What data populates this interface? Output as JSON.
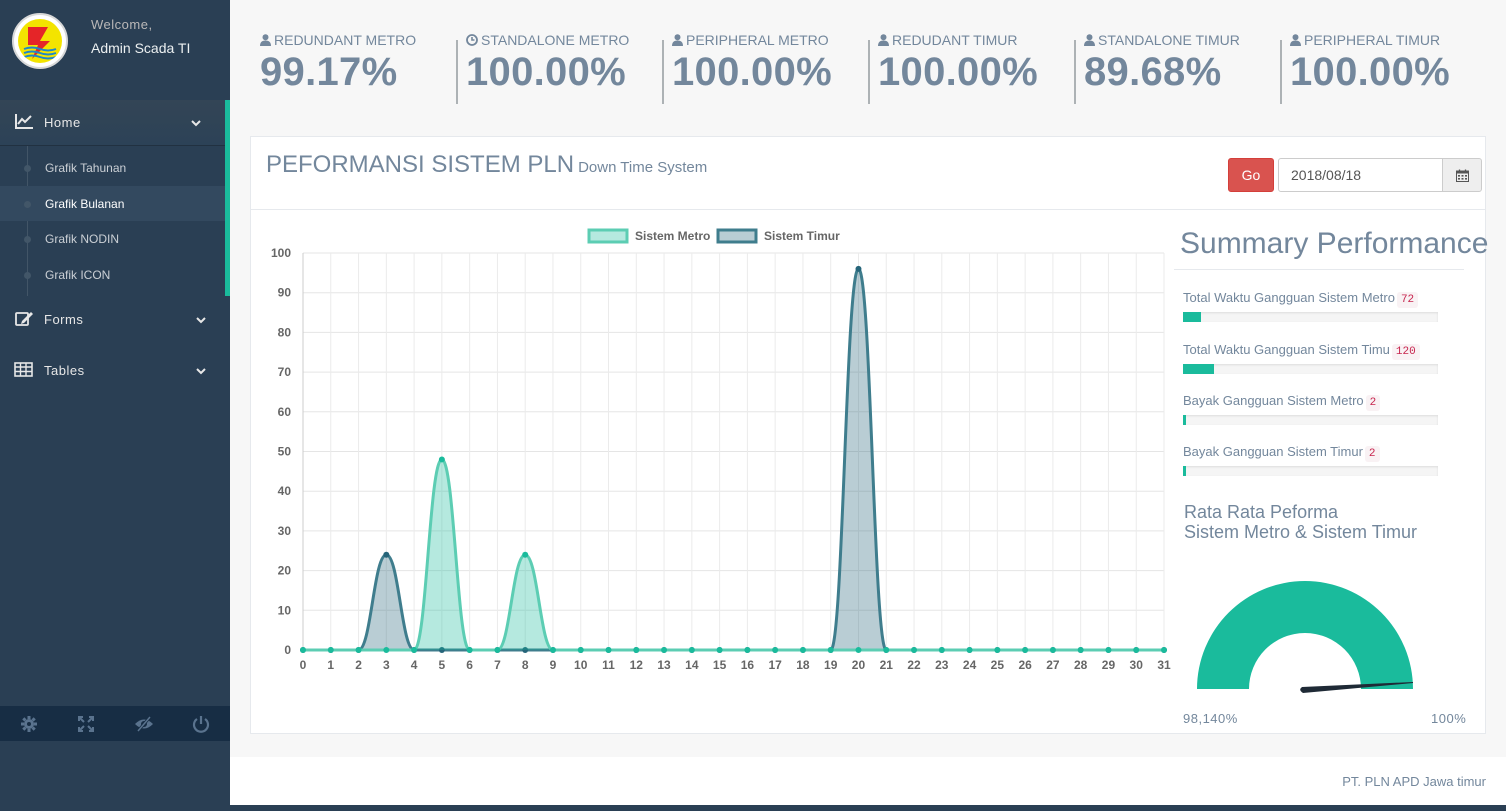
{
  "profile": {
    "welcome": "Welcome,",
    "name": "Admin Scada TI"
  },
  "sidebar": {
    "home_label": "Home",
    "submenu": [
      {
        "label": "Grafik Tahunan",
        "active": false
      },
      {
        "label": "Grafik Bulanan",
        "active": true
      },
      {
        "label": "Grafik NODIN",
        "active": false
      },
      {
        "label": "Grafik ICON",
        "active": false
      }
    ],
    "forms_label": "Forms",
    "tables_label": "Tables",
    "footer_icons": [
      "gear-icon",
      "fullscreen-icon",
      "eye-slash-icon",
      "power-icon"
    ]
  },
  "tiles": [
    {
      "title": "REDUNDANT METRO",
      "count": "99.17%",
      "icon": "user-icon"
    },
    {
      "title": "STANDALONE METRO",
      "count": "100.00%",
      "icon": "clock-icon"
    },
    {
      "title": "PERIPHERAL METRO",
      "count": "100.00%",
      "icon": "user-icon"
    },
    {
      "title": "REDUDANT TIMUR",
      "count": "100.00%",
      "icon": "user-icon"
    },
    {
      "title": "STANDALONE TIMUR",
      "count": "89.68%",
      "icon": "user-icon"
    },
    {
      "title": "PERIPHERAL TIMUR",
      "count": "100.00%",
      "icon": "user-icon"
    }
  ],
  "panel": {
    "title": "PEFORMANSI SISTEM PLN",
    "subtitle": "Down Time System",
    "go_label": "Go",
    "date_value": "2018/08/18"
  },
  "summary": {
    "title": "Summary Performance",
    "rows": [
      {
        "label": "Total Waktu Gangguan Sistem Metro",
        "badge": "72",
        "fill": 0.07
      },
      {
        "label": "Total Waktu Gangguan Sistem Timu",
        "badge": "120",
        "fill": 0.12
      },
      {
        "label": "Bayak Gangguan Sistem Metro",
        "badge": "2",
        "fill": 0.01
      },
      {
        "label": "Bayak Gangguan Sistem Timur",
        "badge": "2",
        "fill": 0.01
      }
    ],
    "gauge_title_1": "Rata Rata Peforma",
    "gauge_title_2": "Sistem Metro & Sistem Timur",
    "gauge_min": "98,140%",
    "gauge_max": "100%",
    "gauge_value": 98.14
  },
  "footer": {
    "text": "PT. PLN APD Jawa timur"
  },
  "colors": {
    "accent": "#1ABB9C",
    "metro": "#1ABB9C",
    "timur": "#26657A",
    "danger": "#D9534F",
    "sidebar": "#2A3F54"
  },
  "chart_data": {
    "type": "area",
    "x": [
      0,
      1,
      2,
      3,
      4,
      5,
      6,
      7,
      8,
      9,
      10,
      11,
      12,
      13,
      14,
      15,
      16,
      17,
      18,
      19,
      20,
      21,
      22,
      23,
      24,
      25,
      26,
      27,
      28,
      29,
      30,
      31
    ],
    "ylim": [
      0,
      100
    ],
    "yticks": [
      0,
      10,
      20,
      30,
      40,
      50,
      60,
      70,
      80,
      90,
      100
    ],
    "legend": "top-center",
    "grid": true,
    "series": [
      {
        "name": "Sistem Metro",
        "values": [
          0,
          0,
          0,
          0,
          0,
          48,
          0,
          0,
          24,
          0,
          0,
          0,
          0,
          0,
          0,
          0,
          0,
          0,
          0,
          0,
          0,
          0,
          0,
          0,
          0,
          0,
          0,
          0,
          0,
          0,
          0,
          0
        ]
      },
      {
        "name": "Sistem Timur",
        "values": [
          0,
          0,
          0,
          24,
          0,
          0,
          0,
          0,
          0,
          0,
          0,
          0,
          0,
          0,
          0,
          0,
          0,
          0,
          0,
          0,
          96,
          0,
          0,
          0,
          0,
          0,
          0,
          0,
          0,
          0,
          0,
          0
        ]
      }
    ]
  }
}
